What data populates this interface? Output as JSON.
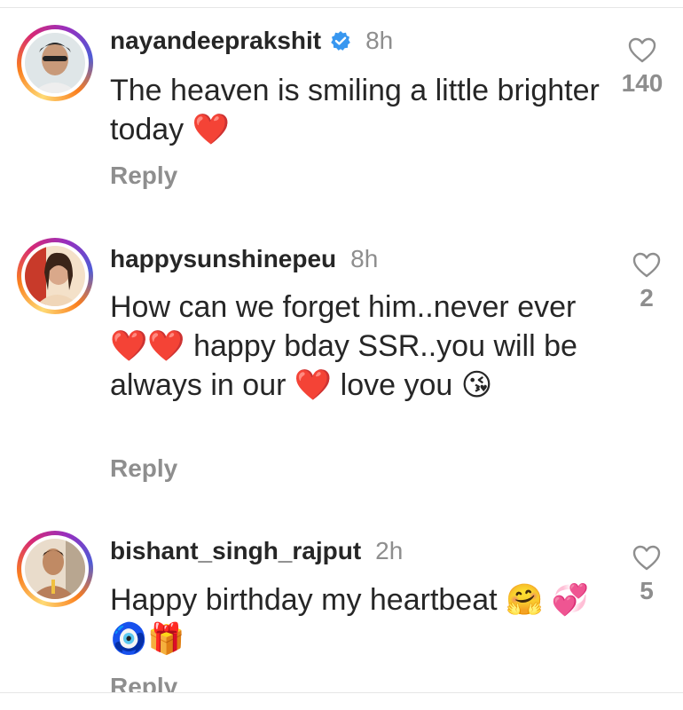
{
  "comments": [
    {
      "username": "nayandeeprakshit",
      "verified": true,
      "time": "8h",
      "text_parts": [
        "The heaven is smiling a little brighter today ",
        "❤️"
      ],
      "reply_label": "Reply",
      "likes": "140"
    },
    {
      "username": "happysunshinepeu",
      "verified": false,
      "time": "8h",
      "text_parts": [
        "How can we forget him..never ever",
        "❤️❤️",
        " happy bday SSR..you will be always in our ",
        "❤️",
        " love you ",
        "😘"
      ],
      "reply_label": "Reply",
      "likes": "2"
    },
    {
      "username": "bishant_singh_rajput",
      "verified": false,
      "time": "2h",
      "text_parts": [
        "Happy birthday my heartbeat ",
        "🤗",
        " ",
        "💞🧿🎁"
      ],
      "reply_label": "Reply",
      "likes": "5"
    }
  ],
  "colors": {
    "verified_badge": "#3897f0",
    "secondary_text": "#8e8e8e",
    "primary_text": "#262626",
    "heart": "#e0245e"
  },
  "icons": {
    "like": "heart-outline-icon",
    "verified": "verified-badge-icon"
  }
}
